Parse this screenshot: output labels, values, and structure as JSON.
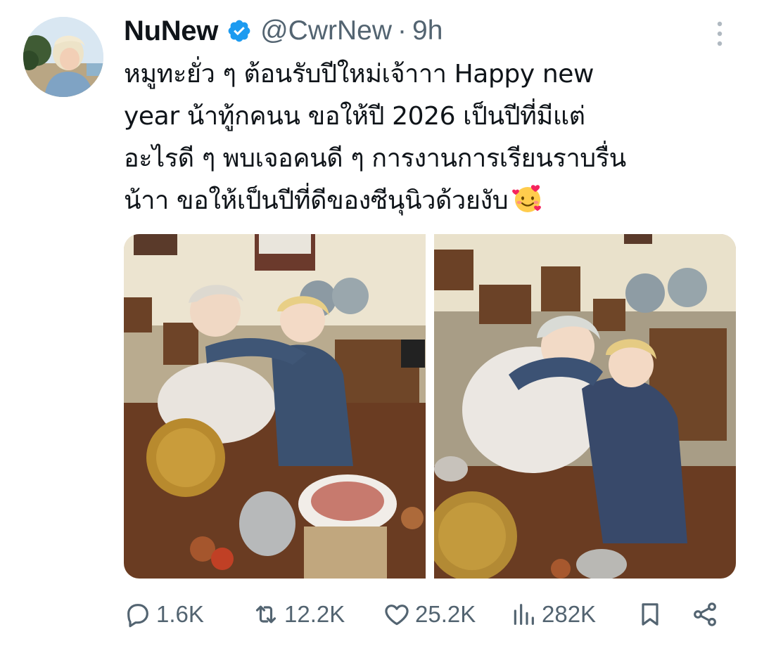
{
  "tweet": {
    "author": {
      "display_name": "NuNew",
      "handle": "@CwrNew",
      "verified": true,
      "avatar_icon": "profile-photo"
    },
    "separator": "·",
    "time_ago": "9h",
    "text_lines": [
      "หมูทะยั่ว ๆ ต้อนรับปีใหม่เจ้าาา Happy new",
      "year น้าทู้กคนน ขอให้ปี 2026 เป็นปีที่มีแต่",
      "อะไรดี ๆ พบเจอคนดี ๆ การงานการเรียนราบรื่น",
      "น้าา ขอให้เป็นปีที่ดีของซีนุนิวด้วยงับ"
    ],
    "emoji_icon": "smiling-face-with-hearts-icon",
    "photos": [
      {
        "icon": "photo-two-people-at-bbq-table"
      },
      {
        "icon": "photo-two-people-posing-at-bbq-table"
      }
    ],
    "actions": {
      "replies": "1.6K",
      "reposts": "12.2K",
      "likes": "25.2K",
      "views": "282K"
    }
  },
  "colors": {
    "text_primary": "#0f1419",
    "text_secondary": "#536471",
    "verified_blue": "#1d9bf0"
  }
}
